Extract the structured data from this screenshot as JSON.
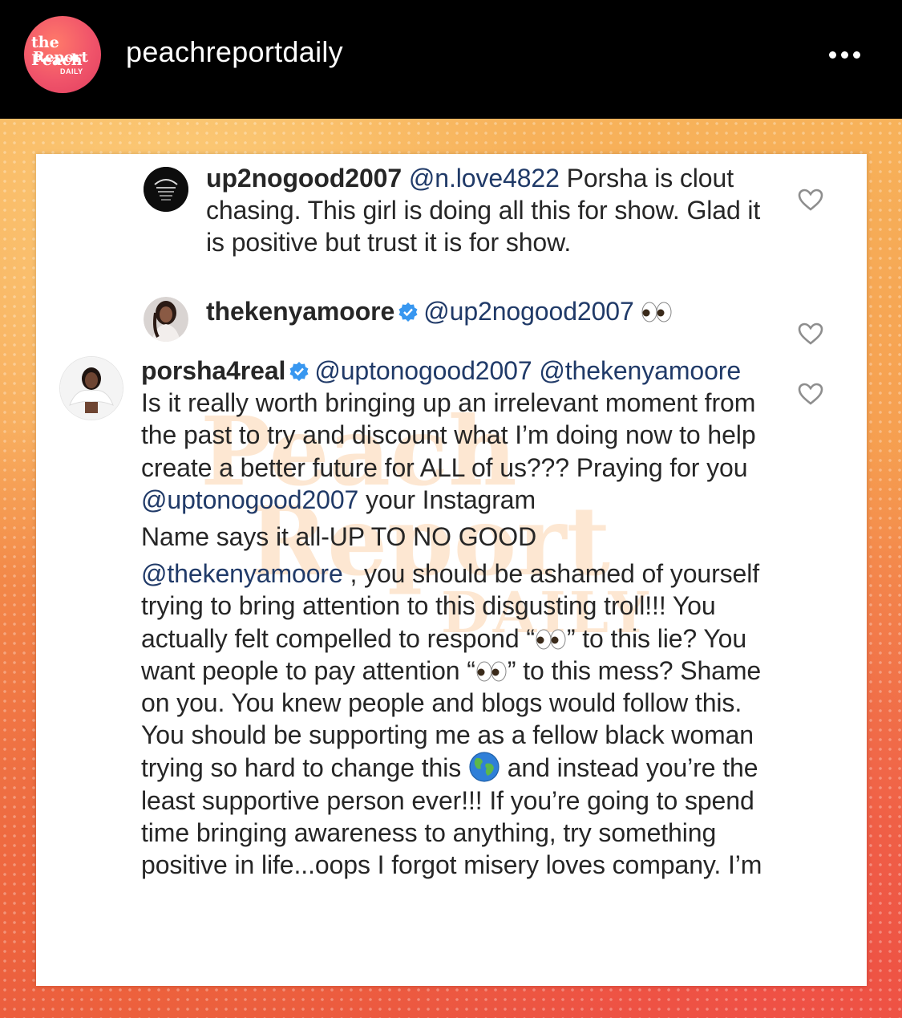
{
  "header": {
    "account_name": "peachreportdaily",
    "avatar_text": [
      "the Peach",
      "Report",
      "DAILY"
    ]
  },
  "post_image": {
    "watermark": [
      "Peach",
      "Report",
      "DAILY"
    ],
    "comments": [
      {
        "username": "up2nogood2007",
        "verified": false,
        "mention": "@n.love4822",
        "text": " Porsha is clout chasing. This girl is doing all this for show. Glad it is positive but trust it is for show."
      },
      {
        "username": "thekenyamoore",
        "verified": true,
        "mention": "@up2nogood2007",
        "text": "",
        "emoji": "eyes"
      },
      {
        "username": "porsha4real",
        "verified": true,
        "mention_1": "@uptonogood2007",
        "mention_2": "@thekenyamoore",
        "text_1": " Is it really worth bringing up an irrelevant moment from the past to try and discount what I’m doing now to help create a better future for ALL of us??? Praying for you ",
        "mention_3": "@uptonogood2007",
        "text_2": " your Instagram",
        "line_name": "Name says it all-UP TO NO GOOD",
        "mention_4": "@thekenyamoore",
        "text_3": " , you should be ashamed of yourself trying to bring attention to this disgusting troll!!! You actually felt compelled to respond “",
        "text_4": "” to this lie? You want people to pay attention “",
        "text_5": "” to this mess? Shame on you. You knew people and blogs would follow this. You should be supporting me as a fellow black woman trying so hard to change this ",
        "text_6": " and instead you’re the least supportive person ever!!! If you’re going to spend time bringing awareness to anything, try something positive in life...oops I forgot misery loves company. I’m"
      }
    ]
  },
  "colors": {
    "header_bg": "#000000",
    "verified_blue": "#3897f0",
    "mention_navy": "#203a68",
    "text": "#262626",
    "background_orange": "#f59a4e"
  }
}
